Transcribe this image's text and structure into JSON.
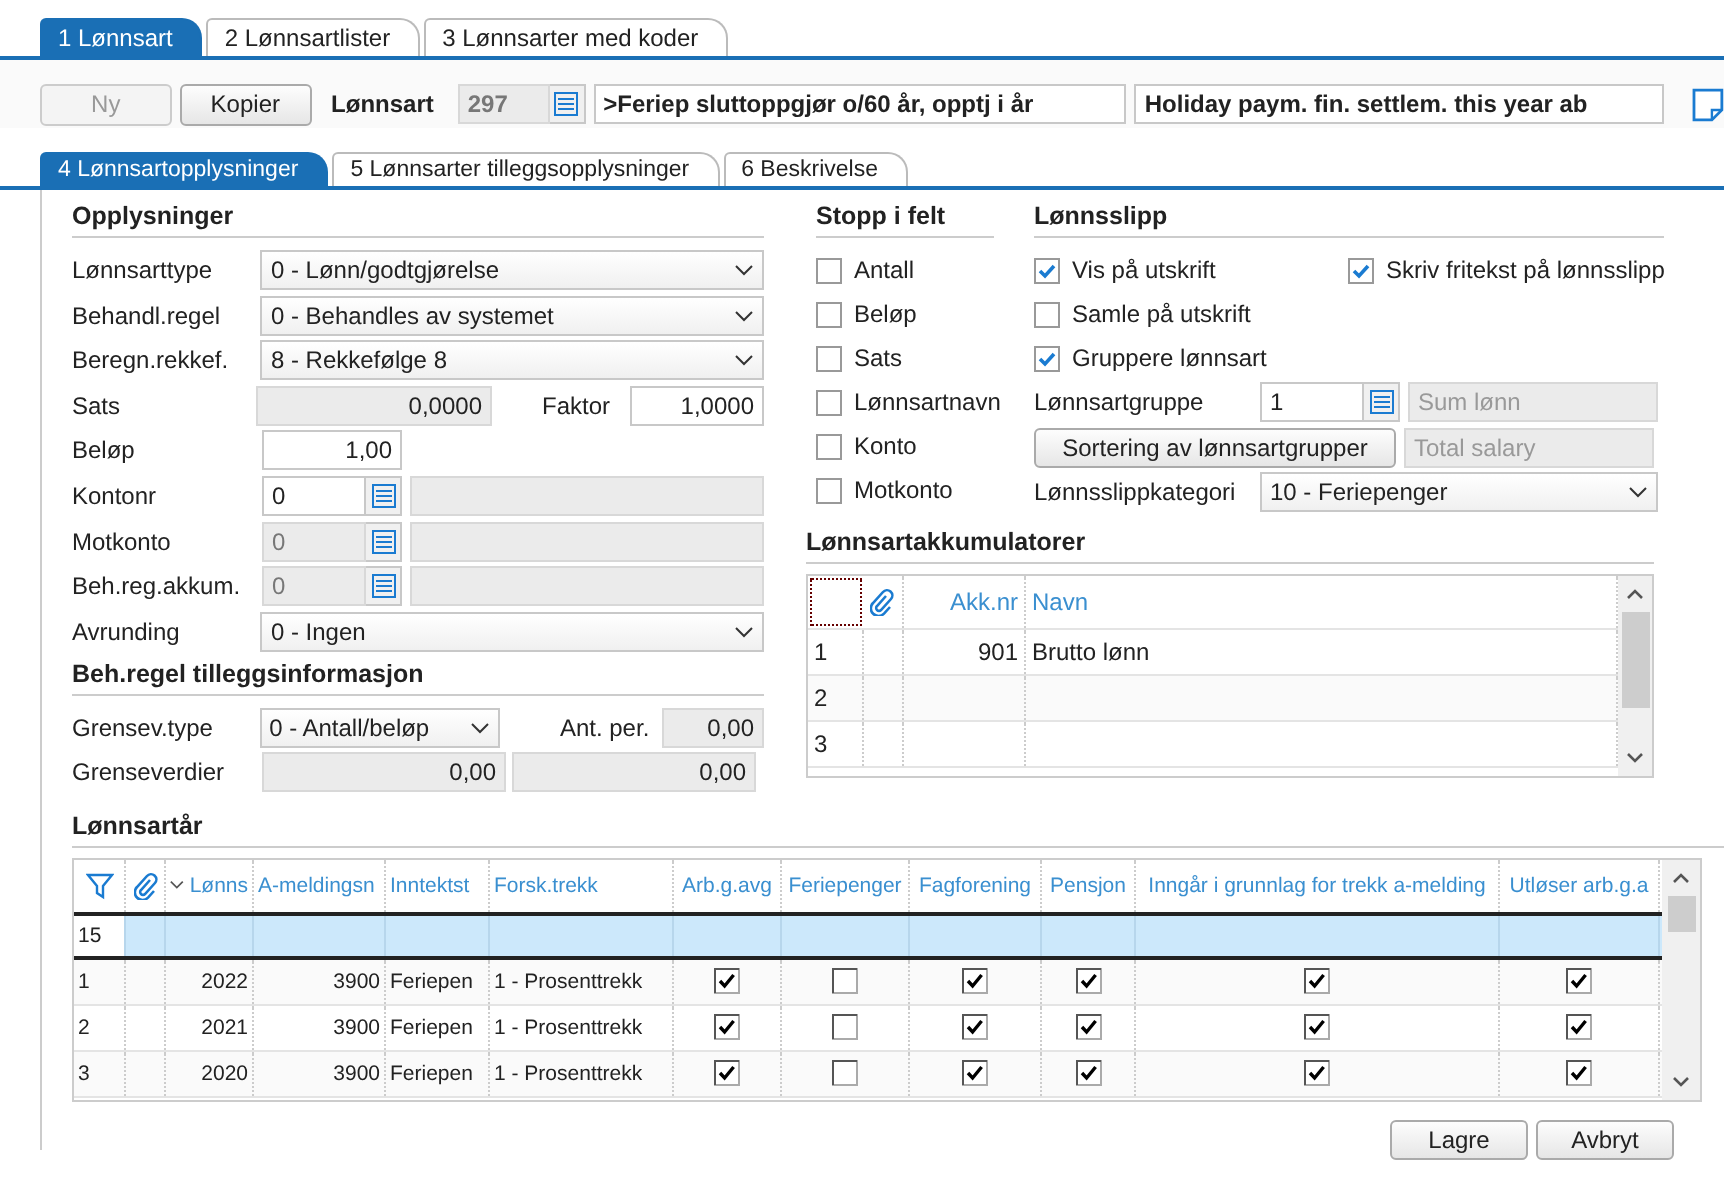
{
  "tabs": [
    {
      "label": "1 Lønnsart",
      "selected": true
    },
    {
      "label": "2 Lønnsartlister",
      "selected": false
    },
    {
      "label": "3 Lønnsarter med koder",
      "selected": false
    }
  ],
  "toolbar": {
    "buttons": [
      {
        "label": "Ny",
        "disabled": true
      },
      {
        "label": "Kopier",
        "disabled": false
      }
    ],
    "label": "Lønnsart",
    "number": "297",
    "name": ">Feriep sluttoppgjør o/60 år, opptj i år",
    "english_name": "Holiday paym. fin. settlem. this year ab"
  },
  "subtabs": [
    {
      "label": "4 Lønnsartopplysninger",
      "selected": true
    },
    {
      "label": "5 Lønnsarter tilleggsopplysninger",
      "selected": false
    },
    {
      "label": "6 Beskrivelse",
      "selected": false
    }
  ],
  "opplysninger": {
    "title": "Opplysninger",
    "fields": [
      {
        "kind": "select",
        "label": "Lønnsarttype",
        "value": "0 - Lønn/godtgjørelse"
      },
      {
        "kind": "select",
        "label": "Behandl.regel",
        "value": "0 - Behandles av systemet"
      },
      {
        "kind": "select",
        "label": "Beregn.rekkef.",
        "value": "8 - Rekkefølge 8"
      },
      {
        "kind": "pair",
        "label": "Sats",
        "value": "0,0000",
        "disabled": true,
        "label_2": "Faktor",
        "value_2": "1,0000"
      },
      {
        "kind": "number",
        "label": "Beløp",
        "value": "1,00",
        "disabled": false
      },
      {
        "kind": "lookup",
        "label": "Kontonr",
        "value": "0",
        "disabled": false
      },
      {
        "kind": "lookup",
        "label": "Motkonto",
        "value": "0",
        "disabled": true
      },
      {
        "kind": "lookup",
        "label": "Beh.reg.akkum.",
        "value": "0",
        "disabled": true
      },
      {
        "kind": "select",
        "label": "Avrunding",
        "value": "0 - Ingen"
      }
    ]
  },
  "tillegg": {
    "title": "Beh.regel tilleggsinformasjon",
    "grensev_type": {
      "label": "Grensev.type",
      "value": "0 - Antall/beløp"
    },
    "ant_per": {
      "label": "Ant. per.",
      "value": "0,00"
    },
    "grenseverdier": {
      "label": "Grenseverdier",
      "values": [
        "0,00",
        "0,00"
      ]
    }
  },
  "stopp": {
    "title": "Stopp i felt",
    "items": [
      {
        "label": "Antall",
        "checked": false
      },
      {
        "label": "Beløp",
        "checked": false
      },
      {
        "label": "Sats",
        "checked": false
      },
      {
        "label": "Lønnsartnavn",
        "checked": false
      },
      {
        "label": "Konto",
        "checked": false
      },
      {
        "label": "Motkonto",
        "checked": false
      }
    ]
  },
  "lonnsslipp": {
    "title": "Lønnsslipp",
    "checks": [
      {
        "label": "Vis på utskrift",
        "checked": true
      },
      {
        "label": "Skriv fritekst på lønnsslipp",
        "checked": true
      },
      {
        "label": "Samle på utskrift",
        "checked": false
      },
      {
        "label": "Gruppere lønnsart",
        "checked": true
      }
    ],
    "gruppe": {
      "label": "Lønnsartgruppe",
      "value": "1",
      "name": "Sum lønn"
    },
    "sort_button": "Sortering av lønnsartgrupper",
    "english_name": "Total salary",
    "kategori": {
      "label": "Lønnsslippkategori",
      "value": "10 - Feriepenger"
    }
  },
  "akkumulatorer": {
    "title": "Lønnsartakkumulatorer",
    "columns": [
      "Akk.nr",
      "Navn"
    ],
    "rows": [
      {
        "number": "1",
        "akk_nr": "901",
        "navn": "Brutto lønn"
      },
      {
        "number": "2"
      },
      {
        "number": "3"
      }
    ]
  },
  "arsgrid": {
    "title": "Lønnsartår",
    "count": "15",
    "columns": [
      "Lønns",
      "A-meldingsn",
      "Inntektst",
      "Forsk.trekk",
      "Arb.g.avg",
      "Feriepenger",
      "Fagforening",
      "Pensjon",
      "Inngår i grunnlag for trekk a-melding",
      "Utløser arb.g.a"
    ],
    "rows": [
      {
        "number": "1",
        "year": "2022",
        "a_melding": "3900",
        "inntektstype": "Feriepen",
        "forsk_trekk": "1 - Prosenttrekk",
        "flags": [
          true,
          false,
          true,
          true,
          true,
          true
        ]
      },
      {
        "number": "2",
        "year": "2021",
        "a_melding": "3900",
        "inntektstype": "Feriepen",
        "forsk_trekk": "1 - Prosenttrekk",
        "flags": [
          true,
          false,
          true,
          true,
          true,
          true
        ]
      },
      {
        "number": "3",
        "year": "2020",
        "a_melding": "3900",
        "inntektstype": "Feriepen",
        "forsk_trekk": "1 - Prosenttrekk",
        "flags": [
          true,
          false,
          true,
          true,
          true,
          true
        ]
      }
    ]
  },
  "buttons": [
    "Lagre",
    "Avbryt"
  ]
}
